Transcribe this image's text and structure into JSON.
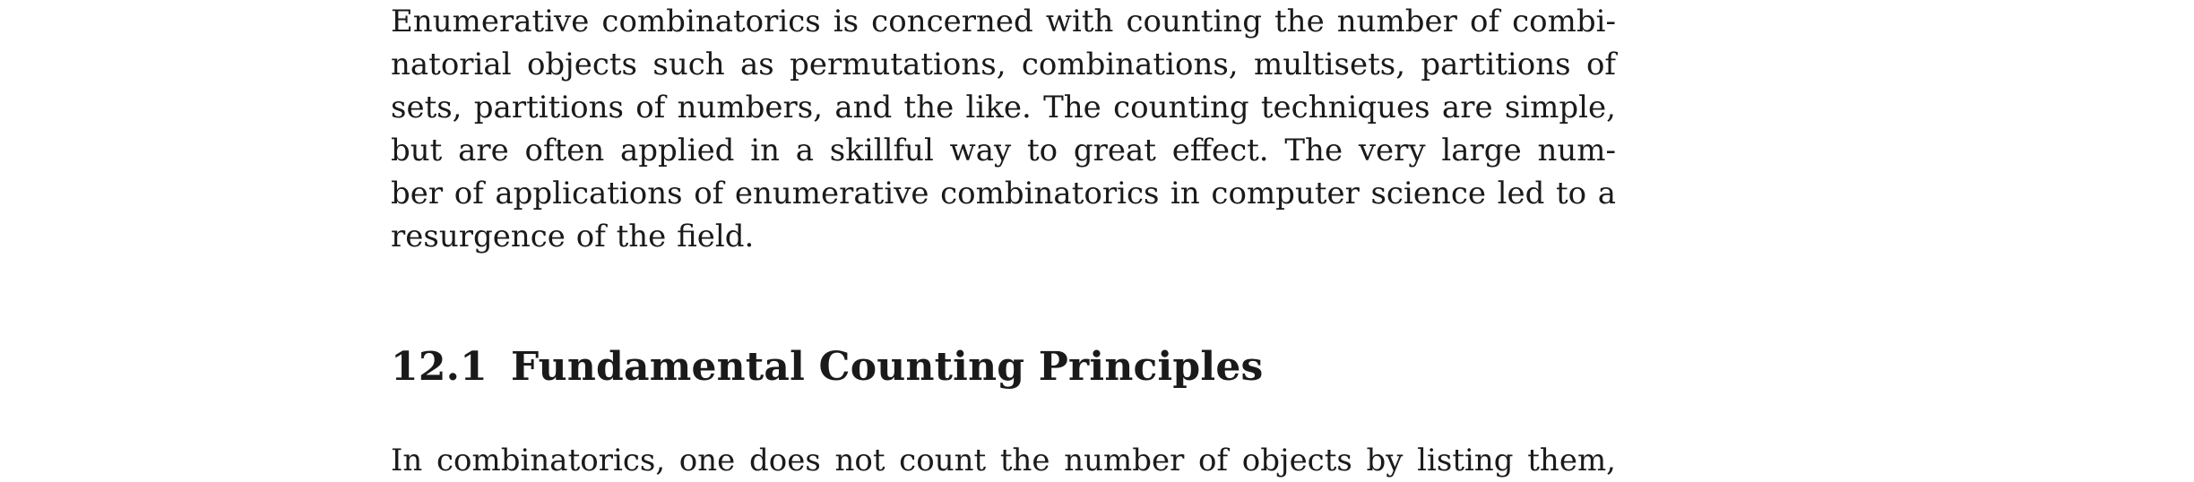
{
  "intro_paragraph": {
    "lines": [
      "Enumerative combinatorics is concerned with counting the number of combi-",
      "natorial objects such as permutations, combinations, multisets, partitions of",
      "sets, partitions of numbers, and the like. The counting techniques are simple,",
      "but are often applied in a skillful way to great effect. The very large num-",
      "ber of applications of enumerative combinatorics in computer science led to a",
      "resurgence of the field."
    ]
  },
  "section": {
    "number": "12.1",
    "title": "Fundamental Counting Principles"
  },
  "section_paragraph": {
    "lines": [
      "In combinatorics, one does not count the number of objects by listing them,"
    ]
  }
}
